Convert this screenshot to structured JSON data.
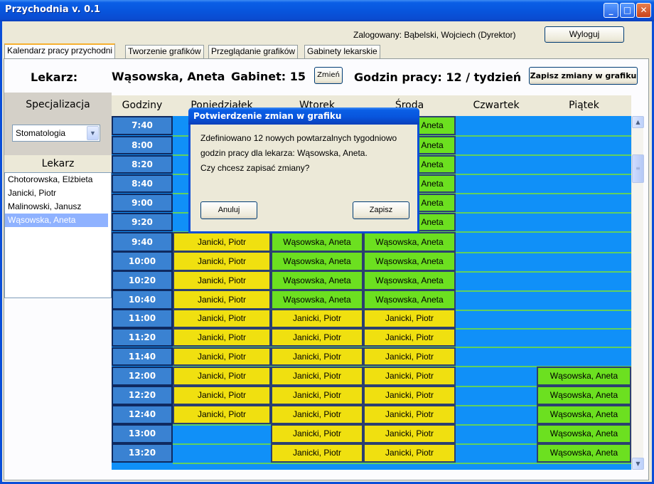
{
  "window": {
    "title": "Przychodnia v. 0.1"
  },
  "top": {
    "logged_in": "Zalogowany: Bąbelski, Wojciech (Dyrektor)",
    "logout_label": "Wyloguj"
  },
  "tabs": [
    {
      "label": "Kalendarz pracy przychodni"
    },
    {
      "label": "Tworzenie grafików"
    },
    {
      "label": "Przeglądanie grafików"
    },
    {
      "label": "Gabinety lekarskie"
    }
  ],
  "header": {
    "doctor_label": "Lekarz:",
    "doctor_name": "Wąsowska, Aneta",
    "room_label": "Gabinet: 15",
    "change_label": "Zmień",
    "hours_label": "Godzin pracy: 12 / tydzień",
    "save_label": "Zapisz zmiany w grafiku"
  },
  "sidebar": {
    "spec_title": "Specjalizacja",
    "spec_value": "Stomatologia",
    "doctor_head": "Lekarz",
    "doctors": [
      "Chotorowska, Elżbieta",
      "Janicki, Piotr",
      "Malinowski, Janusz",
      "Wąsowska, Aneta"
    ],
    "selected_index": 3
  },
  "grid": {
    "columns": [
      "Godziny",
      "Poniedziałek",
      "Wtorek",
      "Środa",
      "Czwartek",
      "Piątek"
    ],
    "times": [
      "7:40",
      "8:00",
      "8:20",
      "8:40",
      "9:00",
      "9:20",
      "9:40",
      "10:00",
      "10:20",
      "10:40",
      "11:00",
      "11:20",
      "11:40",
      "12:00",
      "12:20",
      "12:40",
      "13:00",
      "13:20"
    ],
    "rows": [
      [
        "",
        "",
        "Wąsowska, Aneta",
        "",
        ""
      ],
      [
        "",
        "",
        "Wąsowska, Aneta",
        "",
        ""
      ],
      [
        "",
        "",
        "Wąsowska, Aneta",
        "",
        ""
      ],
      [
        "",
        "",
        "Wąsowska, Aneta",
        "",
        ""
      ],
      [
        "",
        "",
        "Wąsowska, Aneta",
        "",
        ""
      ],
      [
        "",
        "",
        "Wąsowska, Aneta",
        "",
        ""
      ],
      [
        "Janicki, Piotr",
        "Wąsowska, Aneta",
        "Wąsowska, Aneta",
        "",
        ""
      ],
      [
        "Janicki, Piotr",
        "Wąsowska, Aneta",
        "Wąsowska, Aneta",
        "",
        ""
      ],
      [
        "Janicki, Piotr",
        "Wąsowska, Aneta",
        "Wąsowska, Aneta",
        "",
        ""
      ],
      [
        "Janicki, Piotr",
        "Wąsowska, Aneta",
        "Wąsowska, Aneta",
        "",
        ""
      ],
      [
        "Janicki, Piotr",
        "Janicki, Piotr",
        "Janicki, Piotr",
        "",
        ""
      ],
      [
        "Janicki, Piotr",
        "Janicki, Piotr",
        "Janicki, Piotr",
        "",
        ""
      ],
      [
        "Janicki, Piotr",
        "Janicki, Piotr",
        "Janicki, Piotr",
        "",
        ""
      ],
      [
        "Janicki, Piotr",
        "Janicki, Piotr",
        "Janicki, Piotr",
        "",
        "Wąsowska, Aneta"
      ],
      [
        "Janicki, Piotr",
        "Janicki, Piotr",
        "Janicki, Piotr",
        "",
        "Wąsowska, Aneta"
      ],
      [
        "Janicki, Piotr",
        "Janicki, Piotr",
        "Janicki, Piotr",
        "",
        "Wąsowska, Aneta"
      ],
      [
        "",
        "Janicki, Piotr",
        "Janicki, Piotr",
        "",
        "Wąsowska, Aneta"
      ],
      [
        "",
        "Janicki, Piotr",
        "Janicki, Piotr",
        "",
        "Wąsowska, Aneta"
      ]
    ],
    "colors": {
      "janicki": "#f0e010",
      "wasowska": "#6ce020",
      "empty": "#1090f8",
      "hour": "#3a82d2"
    }
  },
  "dialog": {
    "title": "Potwierdzenie zmian w grafiku",
    "lines": [
      "Zdefiniowano 12 nowych powtarzalnych tygodniowo",
      "godzin pracy dla lekarza: Wąsowska, Aneta.",
      "Czy chcesz zapisać zmiany?"
    ],
    "cancel_label": "Anuluj",
    "save_label": "Zapisz"
  }
}
